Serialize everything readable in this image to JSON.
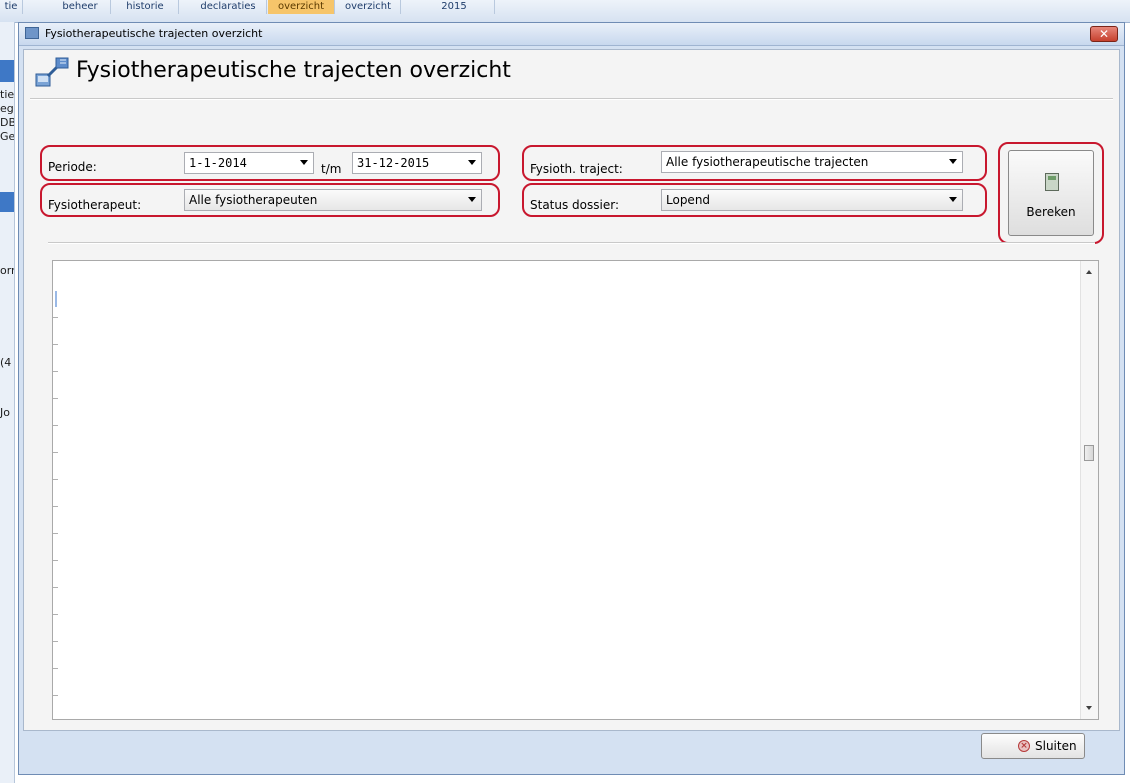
{
  "background": {
    "tabs": [
      "tie",
      "beheer",
      "historie",
      "declaraties",
      "overzicht",
      "overzicht",
      "2015"
    ],
    "left_fragments": [
      "tier",
      "eg",
      "DBC",
      "Geb",
      "orr",
      "(4",
      "Jo"
    ]
  },
  "window": {
    "title": "Fysiotherapeutische trajecten overzicht",
    "close_symbol": "✕"
  },
  "header": {
    "title": "Fysiotherapeutische trajecten overzicht"
  },
  "filters": {
    "periode_label": "Periode:",
    "periode_from": "1-1-2014",
    "tm_label": "t/m",
    "periode_to": "31-12-2015",
    "fysiotherapeut_label": "Fysiotherapeut:",
    "fysiotherapeut_value": "Alle fysiotherapeuten",
    "traject_label": "Fysioth. traject:",
    "traject_value": "Alle fysiotherapeutische trajecten",
    "status_label": "Status dossier:",
    "status_value": "Lopend"
  },
  "actions": {
    "bereken_label": "Bereken",
    "sluiten_label": "Sluiten"
  },
  "colors": {
    "highlight": "#c8172e",
    "window_frame": "#d4e1f2",
    "active_tab": "#f6c56a"
  },
  "icons": {
    "header": "data-transfer-icon",
    "bereken": "calculator-icon",
    "sluiten": "cancel-circle-icon"
  }
}
